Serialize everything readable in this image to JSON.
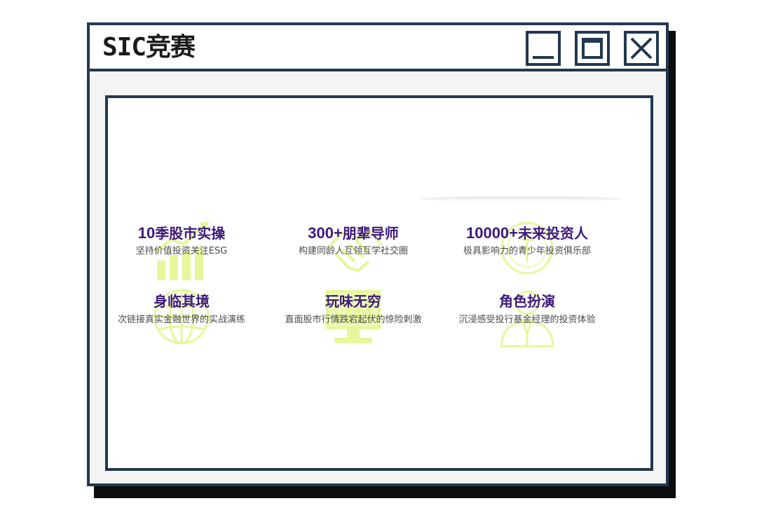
{
  "window": {
    "title": "SIC竞赛",
    "buttons": {
      "minimize": "minimize-icon",
      "maximize": "maximize-icon",
      "close": "close-icon"
    }
  },
  "colors": {
    "frame": "#22384f",
    "title_accent": "#3d1a7a",
    "icon_tint": "#d9f27a"
  },
  "features": [
    {
      "title_num": "10",
      "title_text": "季股市实操",
      "subtitle": "坚持价值投资关注ESG",
      "icon": "bar-chart-icon"
    },
    {
      "title_num": "300+",
      "title_text": "朋辈导师",
      "subtitle": "构建同龄人互领互学社交圈",
      "icon": "handshake-icon"
    },
    {
      "title_num": "10000+",
      "title_text": "未来投资人",
      "subtitle": "极具影响力的青少年投资俱乐部",
      "icon": "coin-icon"
    },
    {
      "title_num": "",
      "title_text": "身临其境",
      "subtitle": "次链接真实金融世界的实战演练",
      "icon": "globe-icon"
    },
    {
      "title_num": "",
      "title_text": "玩味无穷",
      "subtitle": "直面股市行情跌宕起伏的惊险刺激",
      "icon": "monitor-icon"
    },
    {
      "title_num": "",
      "title_text": "角色扮演",
      "subtitle": "沉浸感受投行基金经理的投资体验",
      "icon": "person-icon"
    }
  ]
}
